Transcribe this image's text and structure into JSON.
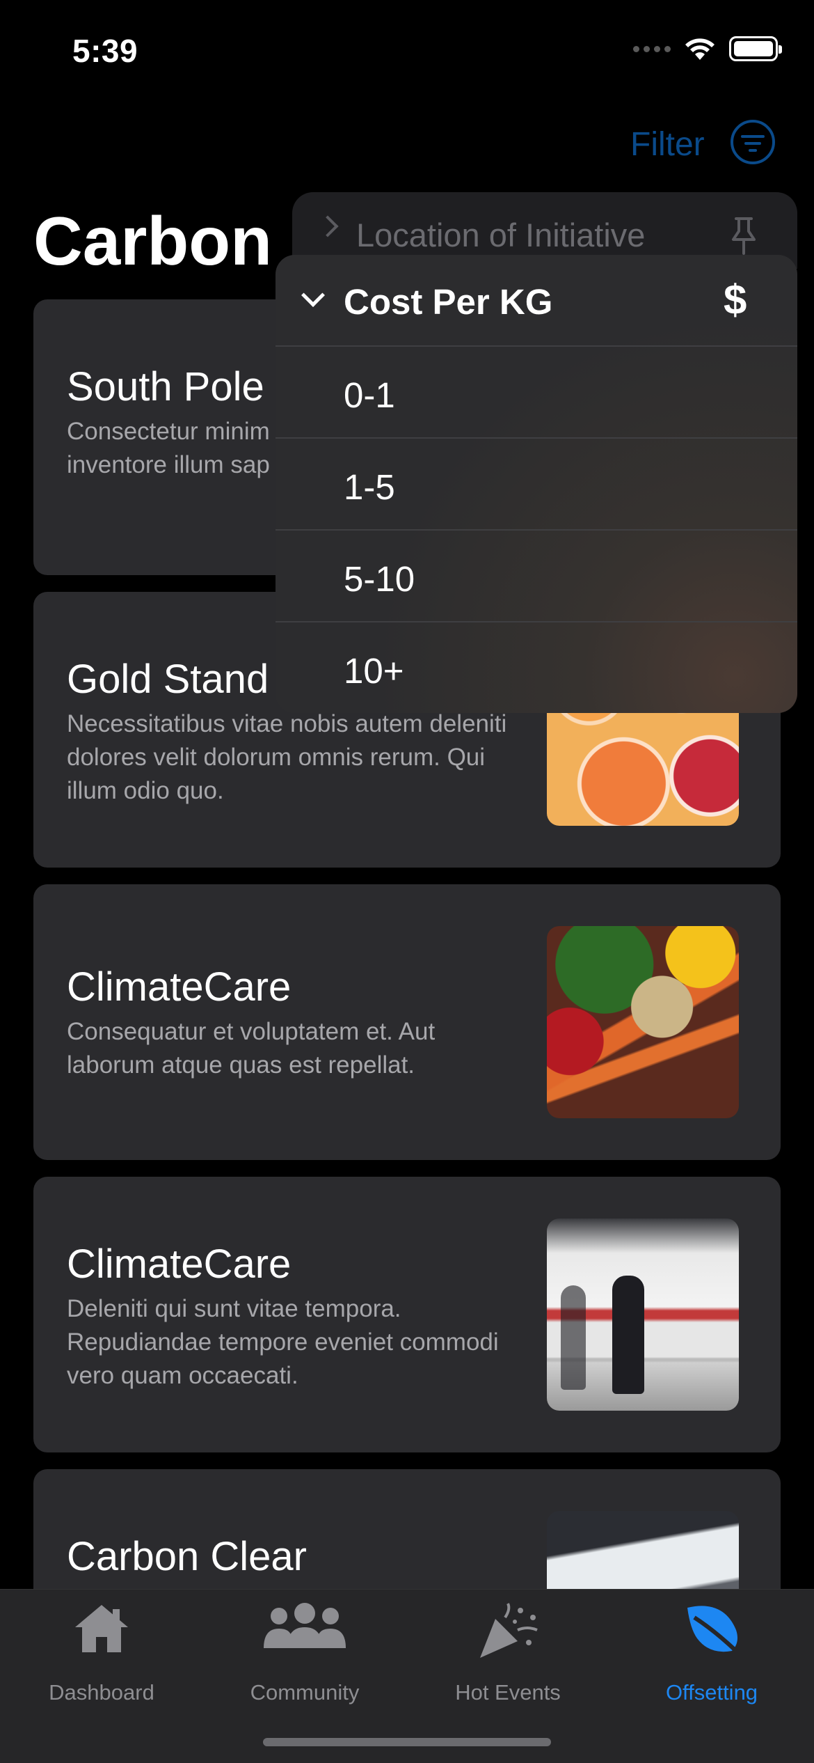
{
  "status": {
    "time": "5:39"
  },
  "header": {
    "filter_label": "Filter",
    "title": "Carbon"
  },
  "cards": [
    {
      "title": "South Pole",
      "desc": "Consectetur minim ducimus voluptate inventore illum sap"
    },
    {
      "title": "Gold Stand",
      "desc": "Necessitatibus vitae nobis autem deleniti dolores velit dolorum omnis rerum. Qui illum odio quo."
    },
    {
      "title": "ClimateCare",
      "desc": "Consequatur et voluptatem et. Aut laborum atque quas est repellat."
    },
    {
      "title": "ClimateCare",
      "desc": "Deleniti qui sunt vitae tempora. Repudiandae tempore eveniet commodi vero quam occaecati."
    },
    {
      "title": "Carbon Clear",
      "desc": ""
    }
  ],
  "filter_menu": {
    "collapsed_section": "Location of Initiative",
    "section_title": "Cost Per KG",
    "section_symbol": "$",
    "options": [
      "0-1",
      "1-5",
      "5-10",
      "10+"
    ]
  },
  "tabs": [
    {
      "label": "Dashboard",
      "icon": "house-icon"
    },
    {
      "label": "Community",
      "icon": "people-icon"
    },
    {
      "label": "Hot Events",
      "icon": "party-popper-icon"
    },
    {
      "label": "Offsetting",
      "icon": "leaf-icon",
      "active": true
    }
  ],
  "colors": {
    "accent": "#1d87f2",
    "card_bg": "#2b2b2e",
    "background": "#000000"
  }
}
